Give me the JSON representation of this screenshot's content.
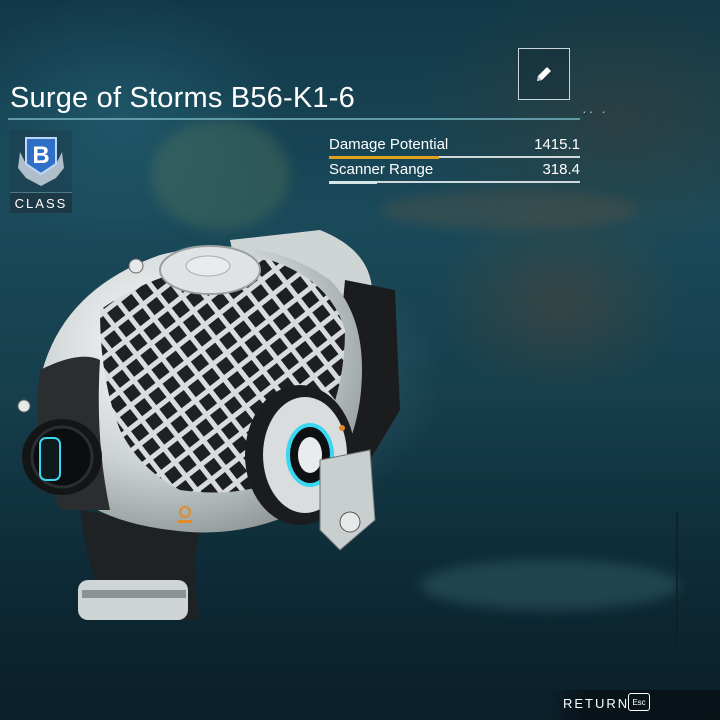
{
  "item": {
    "name": "Surge of Storms B56-K1-6",
    "class_letter": "B",
    "class_label": "CLASS"
  },
  "stats": [
    {
      "label": "Damage Potential",
      "value": "1415.1",
      "fraction": 0.44,
      "color": "#e0a020"
    },
    {
      "label": "Scanner Range",
      "value": "318.4",
      "fraction": 0.19,
      "color": "#d8e6ea"
    }
  ],
  "actions": {
    "edit_icon": "pencil-icon",
    "return_label": "RETURN",
    "return_key": "Esc"
  },
  "colors": {
    "class_badge": "#2f6fc7",
    "accent_line": "#5f9aa6"
  }
}
